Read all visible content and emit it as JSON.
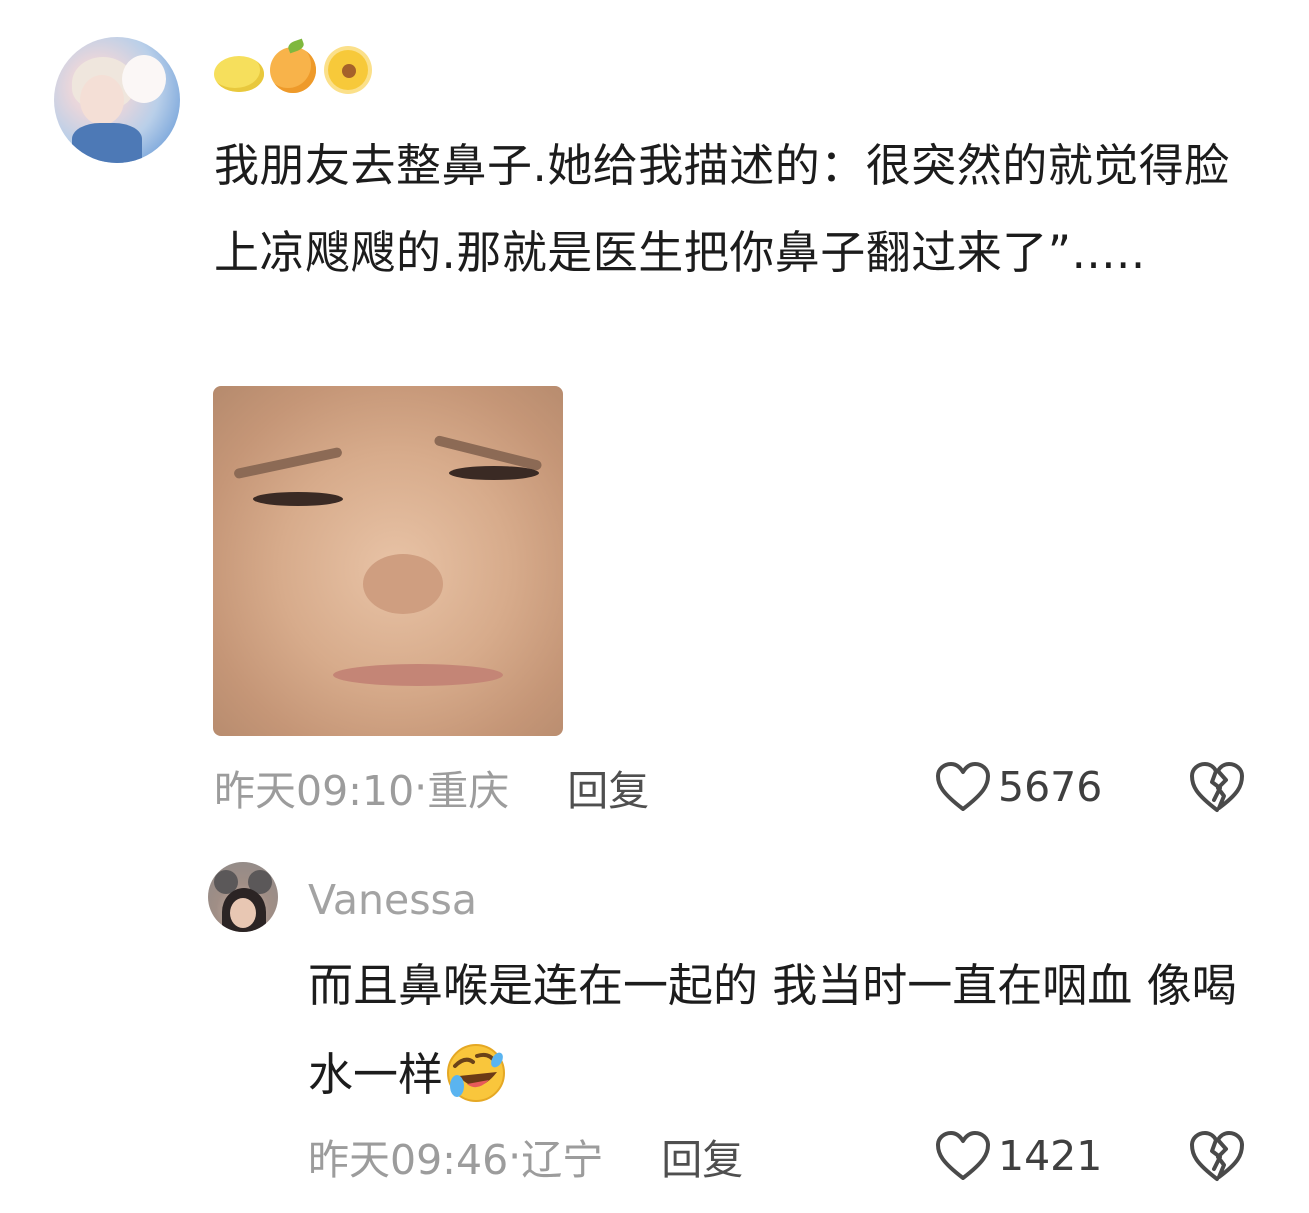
{
  "comment": {
    "text": "我朋友去整鼻子.她给我描述的：很突然的就觉得脸上凉飕飕的.那就是医生把你鼻子翻过来了”.....",
    "badges": [
      "lemon-badge",
      "orange-badge",
      "sunflower-badge"
    ],
    "sticker_icon": "crying-baby-sticker",
    "time": "昨天09:10",
    "separator": " · ",
    "location": "重庆",
    "reply_label": "回复",
    "likes": "5676",
    "like_icon": "heart-outline-icon",
    "dislike_icon": "broken-heart-icon"
  },
  "reply": {
    "username": "Vanessa",
    "text": "而且鼻喉是连在一起的 我当时一直在咽血 像喝水一样",
    "emoji": "rolling-laughing-emoji",
    "time": "昨天09:46",
    "separator": " · ",
    "location": "辽宁",
    "reply_label": "回复",
    "likes": "1421",
    "like_icon": "heart-outline-icon",
    "dislike_icon": "broken-heart-icon"
  },
  "colors": {
    "meta_gray": "#9c9c9c",
    "text_dark": "#1c1c1c",
    "icon_gray": "#4a4a4a"
  }
}
